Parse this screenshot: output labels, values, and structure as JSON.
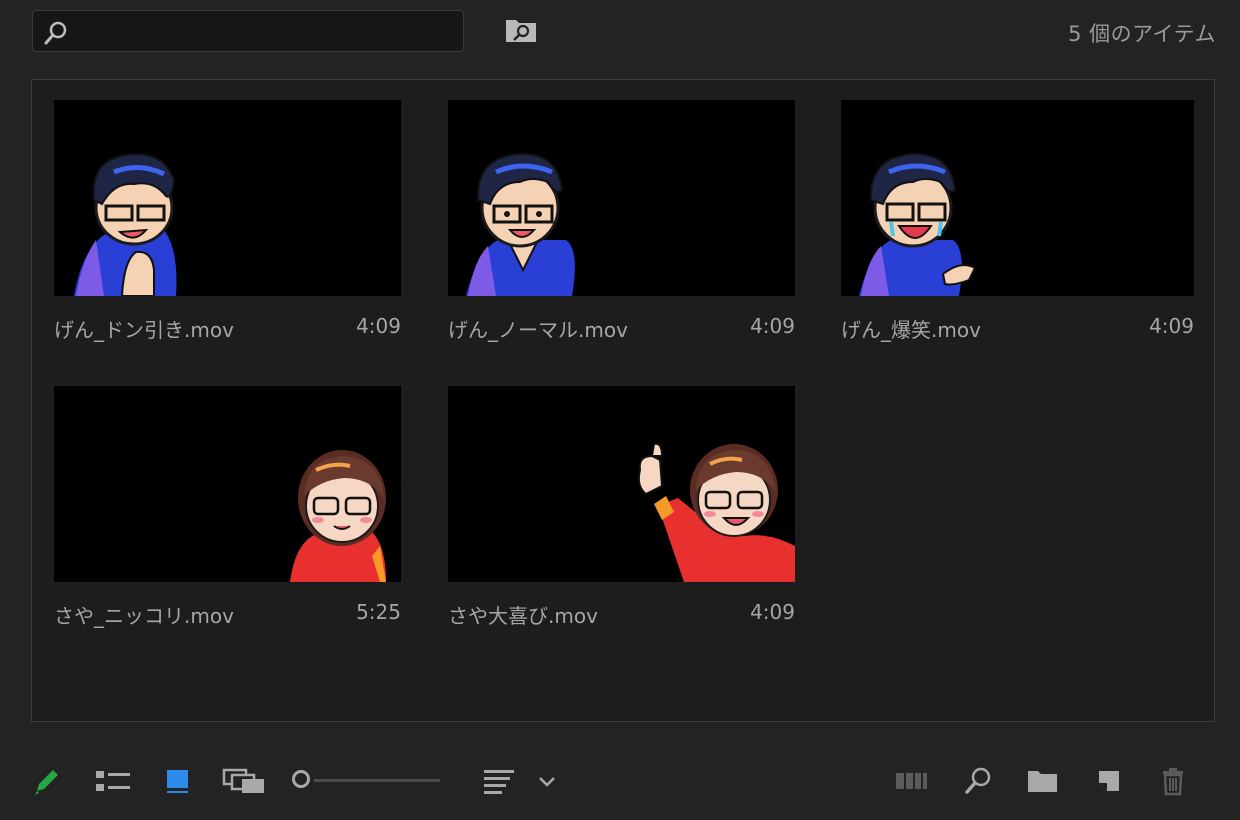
{
  "search": {
    "value": "",
    "placeholder": ""
  },
  "header": {
    "item_count": "5 個のアイテム"
  },
  "items": [
    {
      "name": "げん_ドン引き.mov",
      "duration": "4:09",
      "character": "gen",
      "pose": "hand-chin"
    },
    {
      "name": "げん_ノーマル.mov",
      "duration": "4:09",
      "character": "gen",
      "pose": "normal"
    },
    {
      "name": "げん_爆笑.mov",
      "duration": "4:09",
      "character": "gen",
      "pose": "laugh-point"
    },
    {
      "name": "さや_ニッコリ.mov",
      "duration": "5:25",
      "character": "saya",
      "pose": "smile"
    },
    {
      "name": "さや大喜び.mov",
      "duration": "4:09",
      "character": "saya",
      "pose": "thumbs-up"
    }
  ],
  "toolbar": {
    "icons": [
      "pencil-icon",
      "list-view-icon",
      "icon-view-icon",
      "freeform-view-icon",
      "zoom-slider",
      "sort-icon",
      "chevron-down-icon",
      "automate-to-sequence-icon",
      "find-icon",
      "new-bin-icon",
      "new-item-icon",
      "trash-icon"
    ],
    "zoom_level": 0.0
  },
  "colors": {
    "accent_blue": "#2d8ceb",
    "pencil_green": "#27a644",
    "panel_bg": "#1d1d1d",
    "app_bg": "#232323"
  }
}
